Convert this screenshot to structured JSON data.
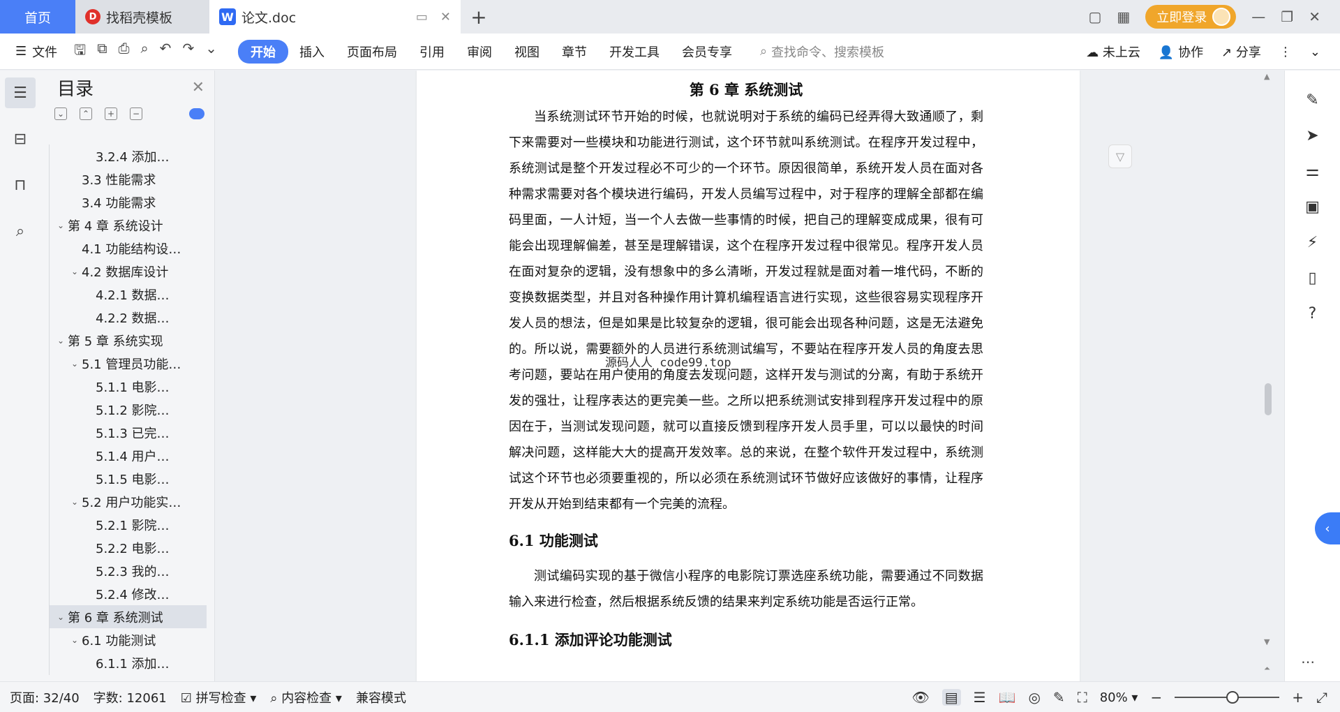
{
  "tabs": {
    "home": "首页",
    "straw": "找稻壳模板",
    "doc": "论文.doc",
    "login": "立即登录"
  },
  "toolbar": {
    "file": "文件",
    "menu": [
      "开始",
      "插入",
      "页面布局",
      "引用",
      "审阅",
      "视图",
      "章节",
      "开发工具",
      "会员专享"
    ],
    "search_placeholder": "查找命令、搜索模板",
    "cloud": "未上云",
    "collab": "协作",
    "share": "分享"
  },
  "toc": {
    "title": "目录",
    "items": [
      {
        "label": "3.2.4 添加…",
        "level": 3,
        "arrow": ""
      },
      {
        "label": "3.3 性能需求",
        "level": 2,
        "arrow": ""
      },
      {
        "label": "3.4 功能需求",
        "level": 2,
        "arrow": ""
      },
      {
        "label": "第 4 章 系统设计",
        "level": 1,
        "arrow": "v"
      },
      {
        "label": "4.1 功能结构设…",
        "level": 2,
        "arrow": ""
      },
      {
        "label": "4.2 数据库设计",
        "level": 2,
        "arrow": "v"
      },
      {
        "label": "4.2.1 数据…",
        "level": 3,
        "arrow": ""
      },
      {
        "label": "4.2.2 数据…",
        "level": 3,
        "arrow": ""
      },
      {
        "label": "第 5 章 系统实现",
        "level": 1,
        "arrow": "v"
      },
      {
        "label": "5.1 管理员功能…",
        "level": 2,
        "arrow": "v"
      },
      {
        "label": "5.1.1 电影…",
        "level": 3,
        "arrow": ""
      },
      {
        "label": "5.1.2 影院…",
        "level": 3,
        "arrow": ""
      },
      {
        "label": "5.1.3 已完…",
        "level": 3,
        "arrow": ""
      },
      {
        "label": "5.1.4 用户…",
        "level": 3,
        "arrow": ""
      },
      {
        "label": "5.1.5 电影…",
        "level": 3,
        "arrow": ""
      },
      {
        "label": "5.2 用户功能实…",
        "level": 2,
        "arrow": "v"
      },
      {
        "label": "5.2.1 影院…",
        "level": 3,
        "arrow": ""
      },
      {
        "label": "5.2.2 电影…",
        "level": 3,
        "arrow": ""
      },
      {
        "label": "5.2.3 我的…",
        "level": 3,
        "arrow": ""
      },
      {
        "label": "5.2.4 修改…",
        "level": 3,
        "arrow": ""
      },
      {
        "label": "第 6 章 系统测试",
        "level": 1,
        "arrow": "v",
        "selected": true
      },
      {
        "label": "6.1 功能测试",
        "level": 2,
        "arrow": "v"
      },
      {
        "label": "6.1.1 添加…",
        "level": 3,
        "arrow": ""
      }
    ]
  },
  "document": {
    "chapter_title": "第 6 章  系统测试",
    "para1": "当系统测试环节开始的时候，也就说明对于系统的编码已经弄得大致通顺了，剩下来需要对一些模块和功能进行测试，这个环节就叫系统测试。在程序开发过程中，系统测试是整个开发过程必不可少的一个环节。原因很简单，系统开发人员在面对各种需求需要对各个模块进行编码，开发人员编写过程中，对于程序的理解全部都在编码里面，一人计短，当一个人去做一些事情的时候，把自己的理解变成成果，很有可能会出现理解偏差，甚至是理解错误，这个在程序开发过程中很常见。程序开发人员在面对复杂的逻辑，没有想象中的多么清晰，开发过程就是面对着一堆代码，不断的变换数据类型，并且对各种操作用计算机编程语言进行实现，这些很容易实现程序开发人员的想法，但是如果是比较复杂的逻辑，很可能会出现各种问题，这是无法避免的。所以说，需要额外的人员进行系统测试编写，不要站在程序开发人员的角度去思考问题，要站在用户使用的角度去发现问题，这样开发与测试的分离，有助于系统开发的强壮，让程序表达的更完美一些。之所以把系统测试安排到程序开发过程中的原因在于，当测试发现问题，就可以直接反馈到程序开发人员手里，可以以最快的时间解决问题，这样能大大的提高开发效率。总的来说，在整个软件开发过程中，系统测试这个环节也必须要重视的，所以必须在系统测试环节做好应该做好的事情，让程序开发从开始到结束都有一个完美的流程。",
    "section_title": "6.1  功能测试",
    "para2": "测试编码实现的基于微信小程序的电影院订票选座系统功能，需要通过不同数据输入来进行检查，然后根据系统反馈的结果来判定系统功能是否运行正常。",
    "subsection_title": "6.1.1  添加评论功能测试",
    "overlay_text": "源码人人 code99.top"
  },
  "status": {
    "page": "页面: 32/40",
    "words": "字数: 12061",
    "spell": "拼写检查",
    "content": "内容检查",
    "compat": "兼容模式",
    "zoom": "80%",
    "zoom_level": 0.55
  },
  "colors": {
    "accent": "#4a7ff7",
    "login": "#f0a62b"
  }
}
